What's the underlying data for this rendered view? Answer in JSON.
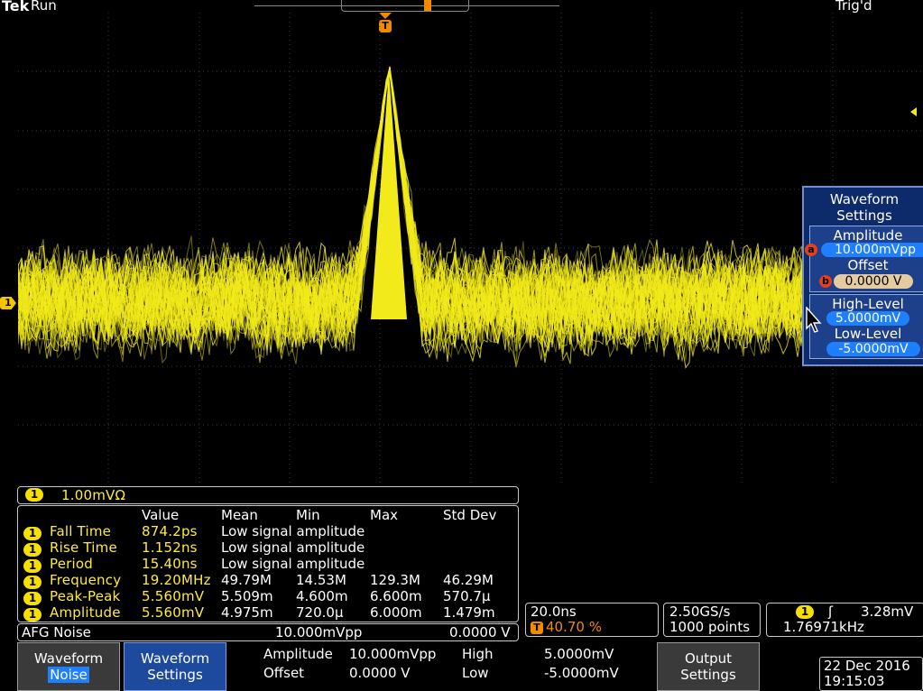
{
  "header": {
    "brand": "Tek",
    "run_state": "Run",
    "trigger_state": "Trig'd"
  },
  "markers": {
    "trigger": "T",
    "channel": "1"
  },
  "colors": {
    "trace": "#f2ea1a",
    "accent_blue": "#1e7fff",
    "panel": "#0d2a6b"
  },
  "channel": {
    "badge": "1",
    "scale": "1.00mVΩ"
  },
  "measurements": {
    "headers": [
      "Value",
      "Mean",
      "Min",
      "Max",
      "Std Dev"
    ],
    "rows": [
      {
        "badge": "1",
        "name": "Fall Time",
        "value": "874.2ps",
        "note": "Low signal amplitude"
      },
      {
        "badge": "1",
        "name": "Rise Time",
        "value": "1.152ns",
        "note": "Low signal amplitude"
      },
      {
        "badge": "1",
        "name": "Period",
        "value": "15.40ns",
        "note": "Low signal amplitude"
      },
      {
        "badge": "1",
        "name": "Frequency",
        "value": "19.20MHz",
        "mean": "49.79M",
        "min": "14.53M",
        "max": "129.3M",
        "std": "46.29M"
      },
      {
        "badge": "1",
        "name": "Peak-Peak",
        "value": "5.560mV",
        "mean": "5.509m",
        "min": "4.600m",
        "max": "6.600m",
        "std": "570.7µ"
      },
      {
        "badge": "1",
        "name": "Amplitude",
        "value": "5.560mV",
        "mean": "4.975m",
        "min": "720.0µ",
        "max": "6.000m",
        "std": "1.479m"
      }
    ]
  },
  "afg": {
    "label": "AFG Noise",
    "amplitude": "10.000mVpp",
    "offset": "0.0000 V"
  },
  "timebase": {
    "scale": "20.0ns",
    "trigger_badge": "T",
    "position": "40.70 %"
  },
  "acquisition": {
    "rate": "2.50GS/s",
    "points": "1000 points"
  },
  "trigger": {
    "badge": "1",
    "slope_icon": "rising-edge",
    "slope_glyph": "ʃ",
    "level": "3.28mV",
    "frequency": "1.76971kHz"
  },
  "side_panel": {
    "title_line1": "Waveform",
    "title_line2": "Settings",
    "amplitude_label": "Amplitude",
    "amplitude_knob": "a",
    "amplitude_value": "10.000mVpp",
    "offset_label": "Offset",
    "offset_knob": "b",
    "offset_value": "0.0000 V",
    "high_label": "High-Level",
    "high_value": "5.0000mV",
    "low_label": "Low-Level",
    "low_value": "-5.0000mV"
  },
  "bottom_menu": {
    "waveform_line1": "Waveform",
    "waveform_line2": "Noise",
    "settings_line1": "Waveform",
    "settings_line2": "Settings",
    "amp_label": "Amplitude",
    "amp_value": "10.000mVpp",
    "offset_label": "Offset",
    "offset_value": "0.0000 V",
    "high_label": "High",
    "high_value": "5.0000mV",
    "low_label": "Low",
    "low_value": "-5.0000mV",
    "output_line1": "Output",
    "output_line2": "Settings"
  },
  "datetime": {
    "date": "22 Dec 2016",
    "time": "19:15:03"
  }
}
